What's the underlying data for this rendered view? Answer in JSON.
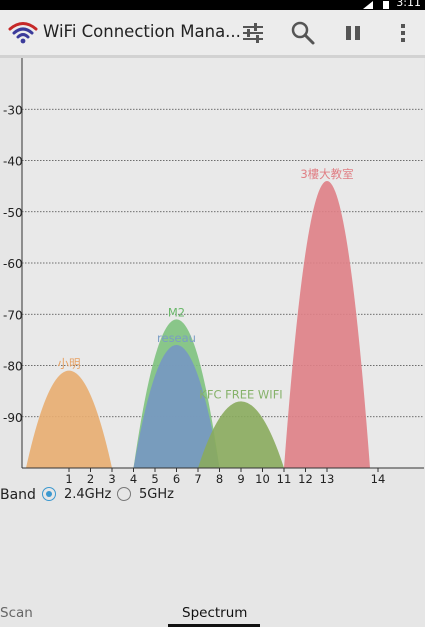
{
  "status_bar": {
    "time": "3:11"
  },
  "app": {
    "title": "WiFi Connection Mana..."
  },
  "toolbar": {
    "filter_icon": "sliders-icon",
    "search_icon": "search-icon",
    "pause_icon": "pause-icon",
    "menu_icon": "overflow-menu-icon"
  },
  "chart_data": {
    "type": "area",
    "y_ticks": [
      -30,
      -40,
      -50,
      -60,
      -70,
      -80,
      -90
    ],
    "y_tick_labels": [
      "-30",
      "-40",
      "-50",
      "-60",
      "-70",
      "-80",
      "-90"
    ],
    "ylim": [
      -100,
      -20
    ],
    "x_ticks": [
      1,
      2,
      3,
      4,
      5,
      6,
      7,
      8,
      9,
      10,
      11,
      12,
      13,
      14
    ],
    "x_tick_labels": [
      "1",
      "2",
      "3",
      "4",
      "5",
      "6",
      "7",
      "8",
      "9",
      "10",
      "11",
      "12",
      "13",
      "14"
    ],
    "grid": "horizontal-dotted",
    "series": [
      {
        "name": "小明",
        "channel": 1,
        "signal_dbm": -81,
        "color": "#e8ad70",
        "label_color": "#e8a060"
      },
      {
        "name": "M2",
        "channel": 6,
        "signal_dbm": -71,
        "color": "#7ec27e",
        "label_color": "#6ab86a"
      },
      {
        "name": "reseau",
        "channel": 6,
        "signal_dbm": -76,
        "color": "#7797c3",
        "label_color": "#7a9cc5"
      },
      {
        "name": "KFC FREE WIFI",
        "channel": 9,
        "signal_dbm": -87,
        "color": "#8aab5d",
        "label_color": "#86b26a"
      },
      {
        "name": "3樓大教室",
        "channel": 13,
        "signal_dbm": -44,
        "color": "#df7f86",
        "label_color": "#e07e84"
      }
    ]
  },
  "band": {
    "label": "Band",
    "options": [
      "2.4GHz",
      "5GHz"
    ],
    "selected": "2.4GHz"
  },
  "tabs": {
    "left": "Scan",
    "active": "Spectrum"
  }
}
